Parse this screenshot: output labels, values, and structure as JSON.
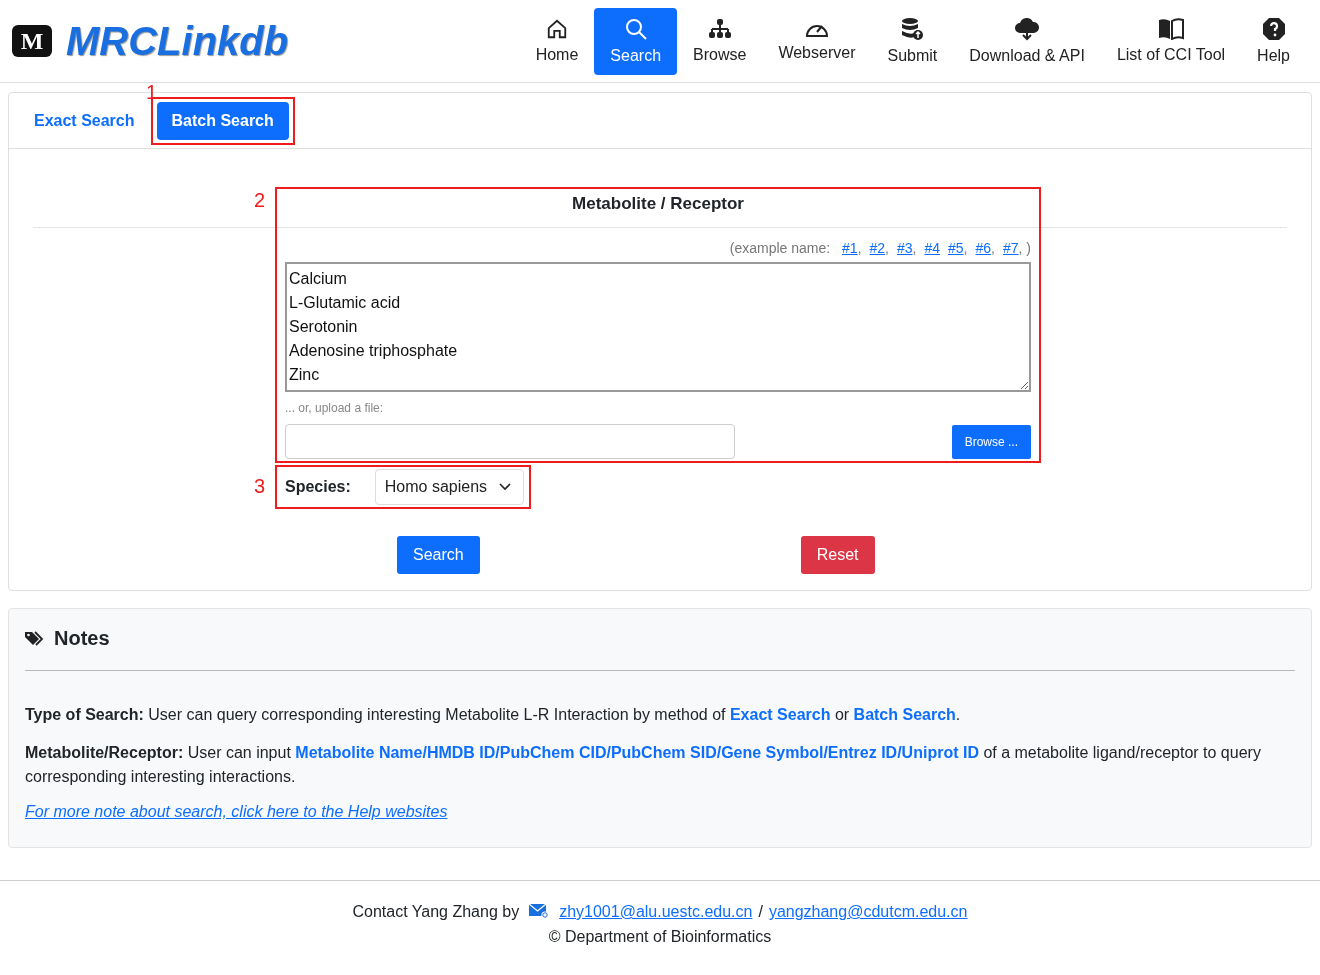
{
  "logo": {
    "badge": "M",
    "name": "MRCLinkdb"
  },
  "nav": [
    {
      "label": "Home",
      "kind": "home",
      "selected": false
    },
    {
      "label": "Search",
      "kind": "search",
      "selected": true
    },
    {
      "label": "Browse",
      "kind": "sitemap",
      "selected": false
    },
    {
      "label": "Webserver",
      "kind": "gauge",
      "selected": false
    },
    {
      "label": "Submit",
      "kind": "database",
      "selected": false
    },
    {
      "label": "Download & API",
      "kind": "download",
      "selected": false
    },
    {
      "label": "List of CCI Tool",
      "kind": "book",
      "selected": false
    },
    {
      "label": "Help",
      "kind": "help",
      "selected": false
    }
  ],
  "search_tabs": [
    {
      "label": "Exact Search",
      "selected": false
    },
    {
      "label": "Batch Search",
      "selected": true
    }
  ],
  "annotations": [
    "1",
    "2",
    "3"
  ],
  "form": {
    "title": "Metabolite / Receptor",
    "example_label": "(example name:",
    "example_links": [
      {
        "label": "#1",
        "after": ","
      },
      {
        "label": "#2",
        "after": ","
      },
      {
        "label": "#3",
        "after": ","
      },
      {
        "label": "#4"
      },
      {
        "label": "#5",
        "after": ","
      },
      {
        "label": "#6",
        "after": ","
      },
      {
        "label": "#7",
        "after": ","
      }
    ],
    "example_close": ")",
    "query_lines": [
      "Calcium",
      "L-Glutamic acid",
      "Serotonin",
      "Adenosine triphosphate",
      "Zinc"
    ],
    "upload_label": "... or, upload a file:",
    "browse_button": "Browse ...",
    "species_label": "Species:",
    "species_value": "Homo sapiens",
    "search_button": "Search",
    "reset_button": "Reset"
  },
  "notes": {
    "title": "Notes",
    "paragraphs": [
      [
        {
          "kind": "bold",
          "text": "Type of Search:"
        },
        {
          "kind": "text",
          "text": " User can query corresponding interesting Metabolite L-R Interaction by method of "
        },
        {
          "kind": "link",
          "text": "Exact Search"
        },
        {
          "kind": "text",
          "text": " or "
        },
        {
          "kind": "link",
          "text": "Batch Search"
        },
        {
          "kind": "text",
          "text": "."
        }
      ],
      [
        {
          "kind": "bold",
          "text": "Metabolite/Receptor:"
        },
        {
          "kind": "text",
          "text": " User can input "
        },
        {
          "kind": "link",
          "text": "Metabolite Name/HMDB ID/PubChem CID/PubChem SID/Gene Symbol/Entrez ID/Uniprot ID"
        },
        {
          "kind": "text",
          "text": " of a metabolite ligand/receptor to query corresponding interesting interactions."
        }
      ]
    ],
    "help_link": "For more note about search, click here to the Help websites"
  },
  "footer": {
    "contact": "Contact Yang Zhang by",
    "emails": [
      "zhy1001@alu.uestc.edu.cn",
      "yangzhang@cdutcm.edu.cn"
    ],
    "separator": "/",
    "copyright": "© Department of Bioinformatics"
  }
}
